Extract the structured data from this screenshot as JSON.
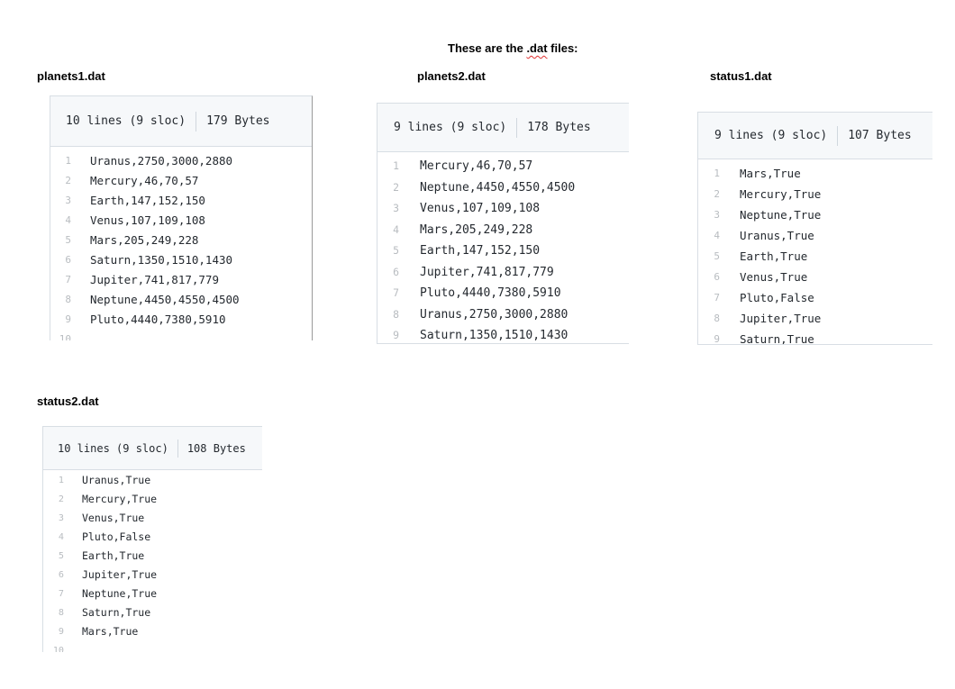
{
  "page_title": {
    "before": "These are the ",
    "flagged": ".dat",
    "after": " files:"
  },
  "files": [
    {
      "id": "planets1",
      "name": "planets1.dat",
      "lines_info": "10 lines (9 sloc)",
      "size": "179 Bytes",
      "lines": [
        "Uranus,2750,3000,2880",
        "Mercury,46,70,57",
        "Earth,147,152,150",
        "Venus,107,109,108",
        "Mars,205,249,228",
        "Saturn,1350,1510,1430",
        "Jupiter,741,817,779",
        "Neptune,4450,4550,4500",
        "Pluto,4440,7380,5910",
        ""
      ]
    },
    {
      "id": "planets2",
      "name": "planets2.dat",
      "lines_info": "9 lines (9 sloc)",
      "size": "178 Bytes",
      "lines": [
        "Mercury,46,70,57",
        "Neptune,4450,4550,4500",
        "Venus,107,109,108",
        "Mars,205,249,228",
        "Earth,147,152,150",
        "Jupiter,741,817,779",
        "Pluto,4440,7380,5910",
        "Uranus,2750,3000,2880",
        "Saturn,1350,1510,1430"
      ]
    },
    {
      "id": "status1",
      "name": "status1.dat",
      "lines_info": "9 lines (9 sloc)",
      "size": "107 Bytes",
      "lines": [
        "Mars,True",
        "Mercury,True",
        "Neptune,True",
        "Uranus,True",
        "Earth,True",
        "Venus,True",
        "Pluto,False",
        "Jupiter,True",
        "Saturn,True"
      ]
    },
    {
      "id": "status2",
      "name": "status2.dat",
      "lines_info": "10 lines (9 sloc)",
      "size": "108 Bytes",
      "lines": [
        "Uranus,True",
        "Mercury,True",
        "Venus,True",
        "Pluto,False",
        "Earth,True",
        "Jupiter,True",
        "Neptune,True",
        "Saturn,True",
        "Mars,True",
        ""
      ]
    }
  ]
}
